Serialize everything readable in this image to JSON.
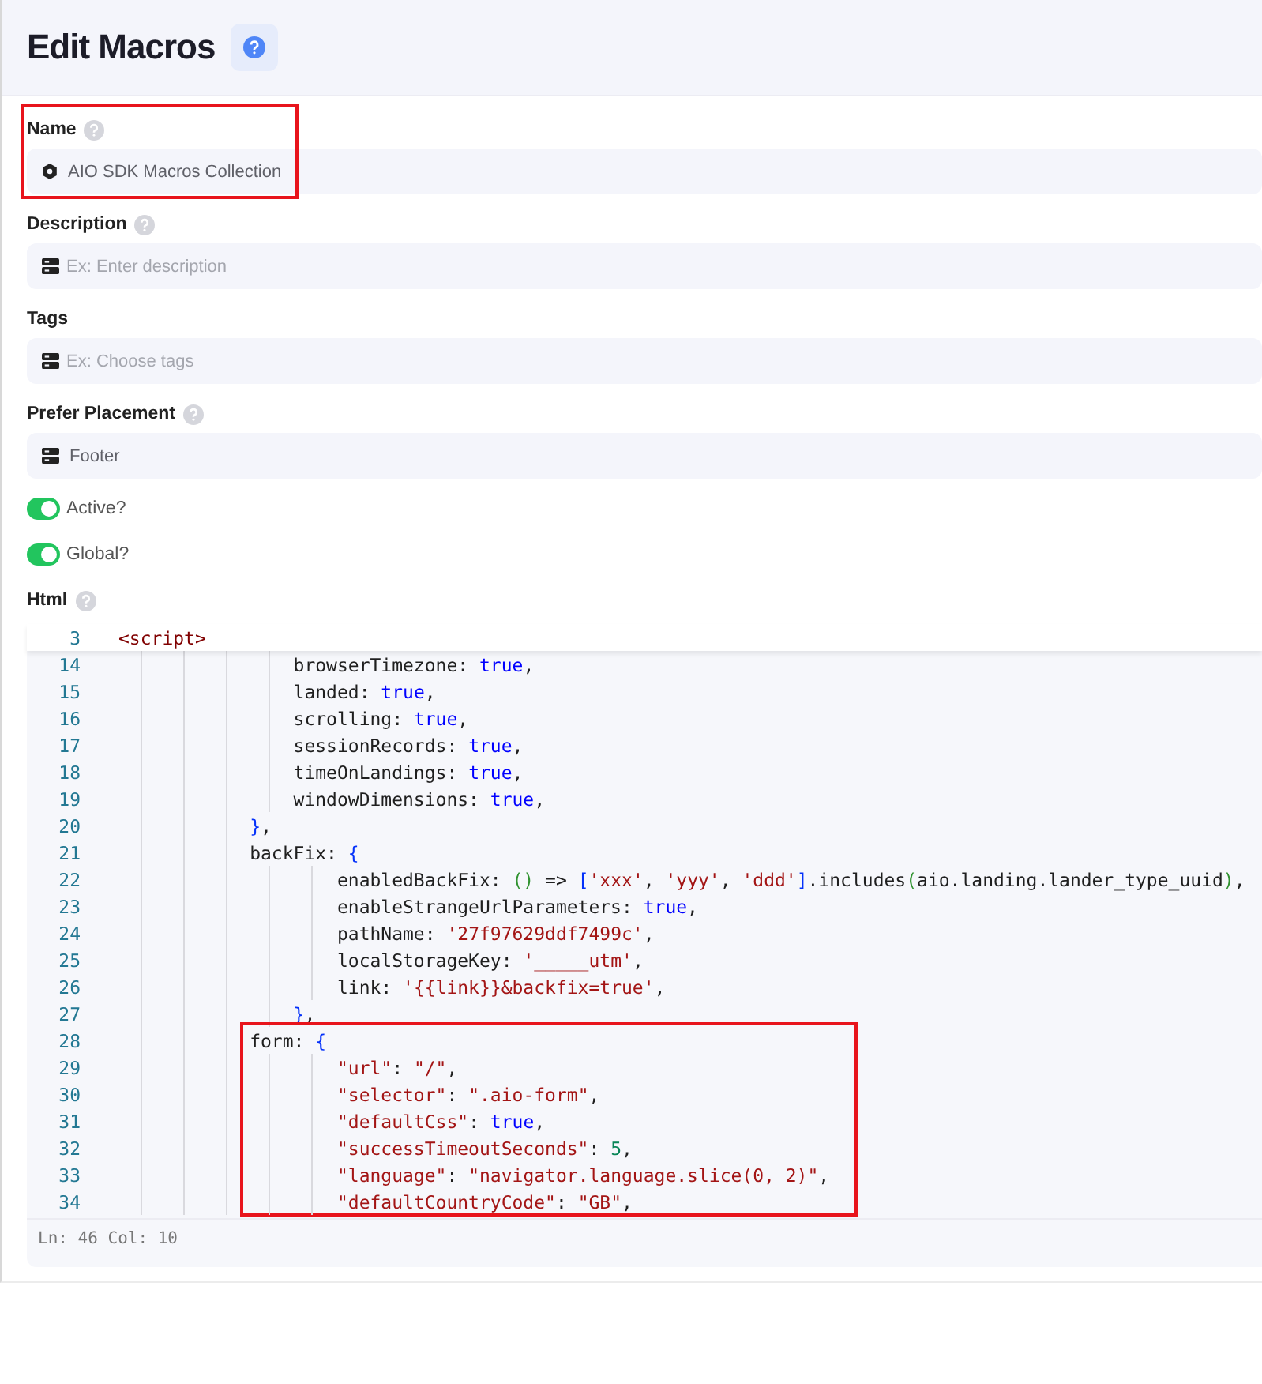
{
  "header": {
    "title": "Edit Macros"
  },
  "fields": [
    {
      "kind": "text",
      "label": "Name",
      "help": true,
      "value": "AIO SDK Macros Collection",
      "highlighted": true
    },
    {
      "kind": "select",
      "label": "Description",
      "help": true,
      "placeholder": "Ex: Enter description",
      "highlighted": false
    },
    {
      "kind": "select",
      "label": "Tags",
      "help": false,
      "placeholder": "Ex: Choose tags",
      "highlighted": false
    },
    {
      "kind": "select",
      "label": "Prefer Placement",
      "help": true,
      "value": "Footer",
      "highlighted": false
    }
  ],
  "toggles": [
    {
      "label": "Active?",
      "on": true
    },
    {
      "label": "Global?",
      "on": true
    }
  ],
  "html": {
    "label": "Html",
    "help": true,
    "sticky_line": {
      "number": "3",
      "tokens": [
        {
          "kind": "tag",
          "text": "<script>"
        }
      ]
    },
    "blocks": [
      {
        "highlighted": false,
        "lines": [
          {
            "number": "14",
            "tokens": [
              {
                "kind": "plain",
                "text": "                browserTimezone: "
              },
              {
                "kind": "keyword",
                "text": "true"
              },
              {
                "kind": "plain",
                "text": ","
              }
            ]
          },
          {
            "number": "15",
            "tokens": [
              {
                "kind": "plain",
                "text": "                landed: "
              },
              {
                "kind": "keyword",
                "text": "true"
              },
              {
                "kind": "plain",
                "text": ","
              }
            ]
          },
          {
            "number": "16",
            "tokens": [
              {
                "kind": "plain",
                "text": "                scrolling: "
              },
              {
                "kind": "keyword",
                "text": "true"
              },
              {
                "kind": "plain",
                "text": ","
              }
            ]
          },
          {
            "number": "17",
            "tokens": [
              {
                "kind": "plain",
                "text": "                sessionRecords: "
              },
              {
                "kind": "keyword",
                "text": "true"
              },
              {
                "kind": "plain",
                "text": ","
              }
            ]
          },
          {
            "number": "18",
            "tokens": [
              {
                "kind": "plain",
                "text": "                timeOnLandings: "
              },
              {
                "kind": "keyword",
                "text": "true"
              },
              {
                "kind": "plain",
                "text": ","
              }
            ]
          },
          {
            "number": "19",
            "tokens": [
              {
                "kind": "plain",
                "text": "                windowDimensions: "
              },
              {
                "kind": "keyword",
                "text": "true"
              },
              {
                "kind": "plain",
                "text": ","
              }
            ]
          },
          {
            "number": "20",
            "tokens": [
              {
                "kind": "bracket",
                "text": "            }"
              },
              {
                "kind": "plain",
                "text": ","
              }
            ]
          },
          {
            "number": "21",
            "tokens": [
              {
                "kind": "plain",
                "text": "            backFix: "
              },
              {
                "kind": "bracket",
                "text": "{"
              }
            ]
          },
          {
            "number": "22",
            "tokens": [
              {
                "kind": "plain",
                "text": "                    enabledBackFix: "
              },
              {
                "kind": "paren",
                "text": "()"
              },
              {
                "kind": "plain",
                "text": " => "
              },
              {
                "kind": "bracket",
                "text": "["
              },
              {
                "kind": "string",
                "text": "'xxx'"
              },
              {
                "kind": "plain",
                "text": ", "
              },
              {
                "kind": "string",
                "text": "'yyy'"
              },
              {
                "kind": "plain",
                "text": ", "
              },
              {
                "kind": "string",
                "text": "'ddd'"
              },
              {
                "kind": "bracket",
                "text": "]"
              },
              {
                "kind": "plain",
                "text": ".includes"
              },
              {
                "kind": "paren",
                "text": "("
              },
              {
                "kind": "plain",
                "text": "aio.landing.lander_type_uuid"
              },
              {
                "kind": "paren",
                "text": ")"
              },
              {
                "kind": "plain",
                "text": ","
              }
            ]
          },
          {
            "number": "23",
            "tokens": [
              {
                "kind": "plain",
                "text": "                    enableStrangeUrlParameters: "
              },
              {
                "kind": "keyword",
                "text": "true"
              },
              {
                "kind": "plain",
                "text": ","
              }
            ]
          },
          {
            "number": "24",
            "tokens": [
              {
                "kind": "plain",
                "text": "                    pathName: "
              },
              {
                "kind": "string",
                "text": "'27f97629ddf7499c'"
              },
              {
                "kind": "plain",
                "text": ","
              }
            ]
          },
          {
            "number": "25",
            "tokens": [
              {
                "kind": "plain",
                "text": "                    localStorageKey: "
              },
              {
                "kind": "string",
                "text": "'_____utm'"
              },
              {
                "kind": "plain",
                "text": ","
              }
            ]
          },
          {
            "number": "26",
            "tokens": [
              {
                "kind": "plain",
                "text": "                    link: "
              },
              {
                "kind": "string",
                "text": "'{{link}}&backfix=true'"
              },
              {
                "kind": "plain",
                "text": ","
              }
            ]
          },
          {
            "number": "27",
            "tokens": [
              {
                "kind": "bracket",
                "text": "                }"
              },
              {
                "kind": "plain",
                "text": ","
              }
            ]
          }
        ]
      },
      {
        "highlighted": true,
        "lines": [
          {
            "number": "28",
            "tokens": [
              {
                "kind": "plain",
                "text": "            form: "
              },
              {
                "kind": "bracket",
                "text": "{"
              }
            ]
          },
          {
            "number": "29",
            "tokens": [
              {
                "kind": "string",
                "text": "                    \"url\""
              },
              {
                "kind": "plain",
                "text": ": "
              },
              {
                "kind": "string",
                "text": "\"/\""
              },
              {
                "kind": "plain",
                "text": ","
              }
            ]
          },
          {
            "number": "30",
            "tokens": [
              {
                "kind": "string",
                "text": "                    \"selector\""
              },
              {
                "kind": "plain",
                "text": ": "
              },
              {
                "kind": "string",
                "text": "\".aio-form\""
              },
              {
                "kind": "plain",
                "text": ","
              }
            ]
          },
          {
            "number": "31",
            "tokens": [
              {
                "kind": "string",
                "text": "                    \"defaultCss\""
              },
              {
                "kind": "plain",
                "text": ": "
              },
              {
                "kind": "keyword",
                "text": "true"
              },
              {
                "kind": "plain",
                "text": ","
              }
            ]
          },
          {
            "number": "32",
            "tokens": [
              {
                "kind": "string",
                "text": "                    \"successTimeoutSeconds\""
              },
              {
                "kind": "plain",
                "text": ": "
              },
              {
                "kind": "number",
                "text": "5"
              },
              {
                "kind": "plain",
                "text": ","
              }
            ]
          },
          {
            "number": "33",
            "tokens": [
              {
                "kind": "string",
                "text": "                    \"language\""
              },
              {
                "kind": "plain",
                "text": ": "
              },
              {
                "kind": "string",
                "text": "\"navigator.language.slice(0, 2)\""
              },
              {
                "kind": "plain",
                "text": ","
              }
            ]
          },
          {
            "number": "34",
            "tokens": [
              {
                "kind": "string",
                "text": "                    \"defaultCountryCode\""
              },
              {
                "kind": "plain",
                "text": ": "
              },
              {
                "kind": "string",
                "text": "\"GB\""
              },
              {
                "kind": "plain",
                "text": ","
              }
            ]
          }
        ]
      }
    ],
    "status": "Ln: 46 Col: 10"
  }
}
